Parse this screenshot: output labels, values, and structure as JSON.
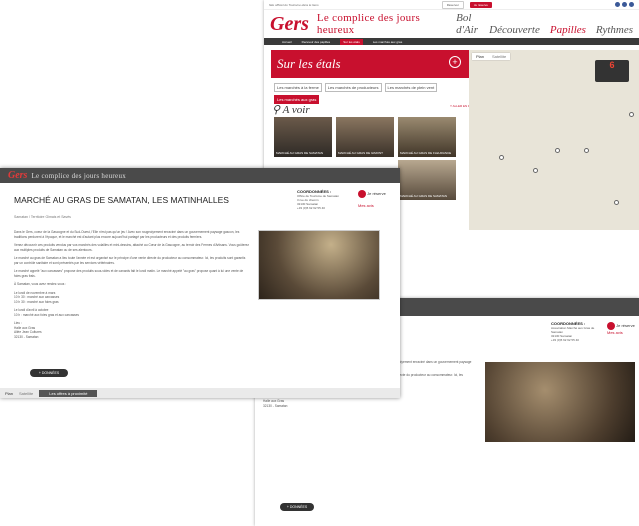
{
  "back": {
    "official": "Site officiel du Tourisme dans le Gers",
    "buttons": [
      "Réserver",
      "Je réserve"
    ],
    "brand": "Gers",
    "tagline": "Le complice des jours heureux",
    "categories": [
      "Bol d'Air",
      "Découverte",
      "Papilles",
      "Rythmes"
    ],
    "subnav": [
      "Accueil",
      "Recevoir des papilles",
      "Sur les étals",
      "Les marchés aux gras"
    ],
    "section_title": "Sur les étals",
    "chips": [
      "Les marchés à la ferme",
      "Les marchés de producteurs",
      "Les marchés de plein vent",
      "Les marchés aux gras"
    ],
    "avoir_title": "A voir",
    "avoir_link": "Y ALLER EN PHOTO",
    "thumbs": [
      "MARCHÉ AU GRAS DE SAMATAN",
      "MARCHÉ AU GRAS DE GIMONT",
      "MARCHÉ AU GRAS DE FLEURANCE",
      "MARCHÉ AU GRAS DE SAMATAN",
      "MARCHÉ AU GRAS DE MIRANDE",
      "MARCHÉ AU GRAS D'EAUZE"
    ],
    "map_tabs": [
      "Plan",
      "Satellite"
    ],
    "map_count": "6"
  },
  "front": {
    "brand": "Gers",
    "tagline": "Le complice des jours heureux",
    "title": "MARCHÉ AU GRAS DE SAMATAN, LES MATINHALLES",
    "breadcrumb": "Samatan / Territoire Gimais et Savès",
    "coords_title": "COORDONNÉES :",
    "coords_lines": [
      "Office de Tourisme de Samatan",
      "3 rue du chemin",
      "32130 Samatan",
      "+33 (0)5 62 62 55 40"
    ],
    "share_label": "Je réserve",
    "fav_label": "Mes avis",
    "paragraphs": [
      "Dans le Gers, coeur de la Gascogne et du Sud-Ouest, l'Elle n'est pas qu'un jeu ! Avec son rougeoiyement enraciné dans un gouvernement paysage gascon, les traditions perdurent à l'époque, et le marché est d'autant plus encore aujourd'hui partagé par les producteurs et des produits fermiers.",
      "Venez découvrir ces produits vendus par vos marchés des volailles et mini-dessins, attaché au Cœur de la Gascogne, au terroir des Fermes d'Artisans. Vous goûterez aux multiples produits de Samatan ou de ses alentours.",
      "Le marché au gras de Samatan a lieu toute l'année et est organisé sur le principe d'une vente directe du producteur au consommateur. Ici, les produits sont garantis par un contrôle sanitaire et sont présentés par les services vétérinaires.",
      "Le marché appelé \"aux carcasses\" propose des produits sous-vides et de canards fait le lundi matin. Le marché appelé \"au gras\" propose quant à lui une vente de foies gras frais.",
      "À Samatan, vous avez rendez-vous :",
      "Le lundi de novembre à mars\n10 h 30 : marché aux carcasses\n10 h 30 : marché aux foies gras",
      "Le lundi d'avril à octobre\n10 h : marché aux foies gras et aux carcasses",
      "Lieu :\nHalle aux Gras\nAllée Jean Cultures\n32130 - Samatan"
    ],
    "more_button": "+ DONNÉES",
    "map_tabs": [
      "Plan",
      "Satellite"
    ],
    "offers": "Les offres à proximité"
  },
  "third": {
    "coords_title": "COORDONNÉES :",
    "coords_lines": [
      "Association Marché aux Gras de Samatan",
      "32130 Samatan",
      "+33 (0)5 62 62 55 40"
    ],
    "share_label": "Je réserve",
    "fav_label": "Mes avis",
    "paragraphs": [
      "Dans le Gers, coeur de la Gascogne et du Sud-Ouest, l'Elle n'est pas qu'un jeu ! Avec son rougeoiyement enraciné dans un gouvernement paysage gascon, les traditions perdurent.",
      "Le marché au gras de Samatan a lieu toute l'année et est organisé sur le principe d'une vente directe du producteur au consommateur. Ici, les produits sont garantis par un contrôle sanitaire et sont présentés par les services vétérinaires.",
      "À Samatan, vous avez rendez-vous :",
      "Lieu :\nHalle aux Gras\n32130 - Samatan"
    ],
    "more_button": "+ DONNÉES"
  },
  "colors": {
    "accent": "#c8102e",
    "dark": "#4a4a4a"
  }
}
